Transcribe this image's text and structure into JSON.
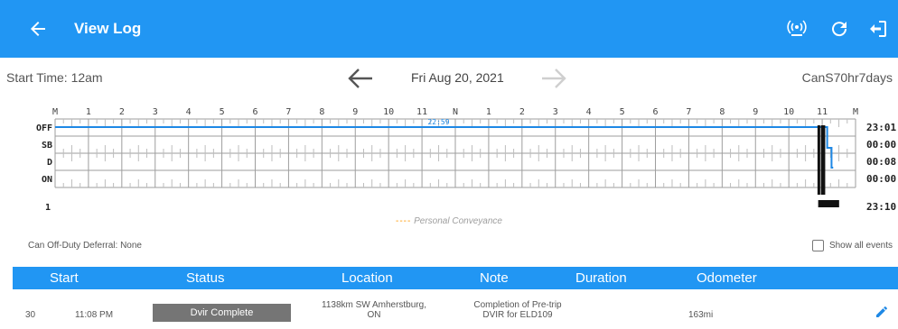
{
  "app_bar": {
    "title": "View Log",
    "icons": [
      "back-arrow-icon",
      "eld-connection-icon",
      "refresh-icon",
      "logout-icon"
    ],
    "color": "#2196f3"
  },
  "log_header": {
    "start_time": "Start Time: 12am",
    "date": "Fri Aug 20, 2021",
    "cycle": "CanS70hr7days"
  },
  "graph": {
    "hour_labels": [
      "M",
      "1",
      "2",
      "3",
      "4",
      "5",
      "6",
      "7",
      "8",
      "9",
      "10",
      "11",
      "N",
      "1",
      "2",
      "3",
      "4",
      "5",
      "6",
      "7",
      "8",
      "9",
      "10",
      "11",
      "M"
    ],
    "status_labels": [
      "OFF",
      "SB",
      "D",
      "ON"
    ],
    "totals": [
      "23:01",
      "00:00",
      "00:08",
      "00:00"
    ],
    "grand_total": "23:10",
    "row_marker": "1",
    "duty_marker_label": "22:59",
    "legend": "Personal Conveyance",
    "line_color": "#1e88e5",
    "pc_color": "#ff9800"
  },
  "deferral": "Can Off-Duty Deferral: None",
  "show_all_events": "Show all events",
  "table": {
    "headers": [
      "Start",
      "Status",
      "Location",
      "Note",
      "Duration",
      "Odometer"
    ],
    "rows": [
      {
        "index": "30",
        "start": "11:08 PM",
        "status": "Dvir Complete",
        "location_line1": "1138km SW Amherstburg,",
        "location_line2": "ON",
        "note_line1": "Completion of  Pre-trip",
        "note_line2": "DVIR for ELD109",
        "duration": "",
        "odometer": "163mi"
      }
    ]
  }
}
